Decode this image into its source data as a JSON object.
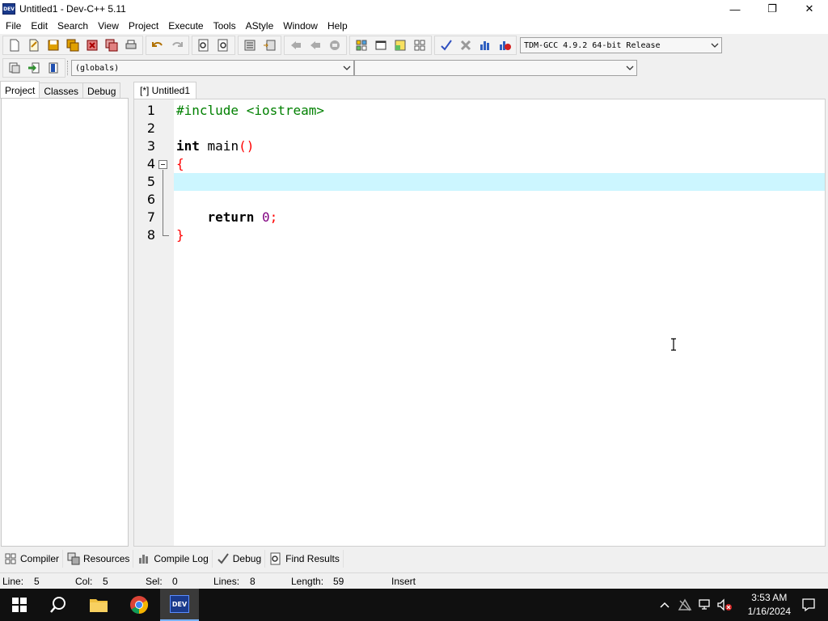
{
  "window": {
    "title": "Untitled1 - Dev-C++ 5.11",
    "icon_text": "DEV",
    "min_glyph": "—",
    "restore_glyph": "❐",
    "close_glyph": "✕"
  },
  "menu": [
    "File",
    "Edit",
    "Search",
    "View",
    "Project",
    "Execute",
    "Tools",
    "AStyle",
    "Window",
    "Help"
  ],
  "toolbar": {
    "compiler_select": "TDM-GCC 4.9.2 64-bit Release",
    "scope_select": "(globals)",
    "member_select": ""
  },
  "left_panel": {
    "tabs": [
      "Project",
      "Classes",
      "Debug"
    ],
    "active_tab": "Project"
  },
  "editor": {
    "tab_label": "[*] Untitled1",
    "current_line": 5,
    "lines": [
      {
        "n": "1",
        "text": "#include <iostream>"
      },
      {
        "n": "2",
        "text": ""
      },
      {
        "n": "3",
        "kw": "int",
        "rest": " main",
        "br": "()"
      },
      {
        "n": "4",
        "br": "{"
      },
      {
        "n": "5",
        "text": ""
      },
      {
        "n": "6",
        "text": ""
      },
      {
        "n": "7",
        "indent": "    ",
        "kw": "return",
        "sp": " ",
        "num": "0",
        "sym": ";"
      },
      {
        "n": "8",
        "br": "}"
      }
    ]
  },
  "bottom_tabs": [
    "Compiler",
    "Resources",
    "Compile Log",
    "Debug",
    "Find Results"
  ],
  "status": {
    "line_label": "Line:",
    "line_value": "5",
    "col_label": "Col:",
    "col_value": "5",
    "sel_label": "Sel:",
    "sel_value": "0",
    "lines_label": "Lines:",
    "lines_value": "8",
    "length_label": "Length:",
    "length_value": "59",
    "mode": "Insert"
  },
  "taskbar": {
    "time": "3:53 AM",
    "date": "1/16/2024",
    "dev_text": "DEV"
  }
}
